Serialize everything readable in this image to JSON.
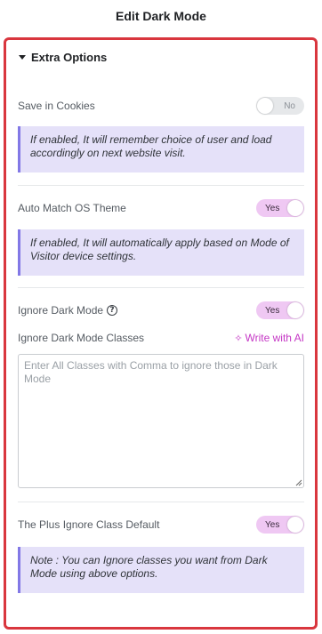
{
  "header": {
    "title": "Edit Dark Mode"
  },
  "section": {
    "title": "Extra Options"
  },
  "save_cookies": {
    "label": "Save in Cookies",
    "toggle": "No",
    "note": "If enabled, It will remember choice of user and load accordingly on next website visit."
  },
  "auto_match": {
    "label": "Auto Match OS Theme",
    "toggle": "Yes",
    "note": "If enabled, It will automatically apply based on Mode of Visitor device settings."
  },
  "ignore_dark": {
    "label": "Ignore Dark Mode",
    "help_icon": "?",
    "toggle": "Yes"
  },
  "ignore_classes": {
    "label": "Ignore Dark Mode Classes",
    "ai_label": "Write with AI",
    "ai_icon": "sparkle-icon",
    "placeholder": "Enter All Classes with Comma to ignore those in Dark Mode",
    "value": ""
  },
  "plus_ignore": {
    "label": "The Plus Ignore Class Default",
    "toggle": "Yes",
    "note": "Note : You can Ignore classes you want from Dark Mode using above options."
  },
  "colors": {
    "frame_border": "#d9363e",
    "toggle_on": "#efc8f3",
    "toggle_off": "#e6e8ea",
    "note_bg": "#e5e1f9",
    "note_border": "#8278e6",
    "ai_accent": "#c537c5"
  }
}
